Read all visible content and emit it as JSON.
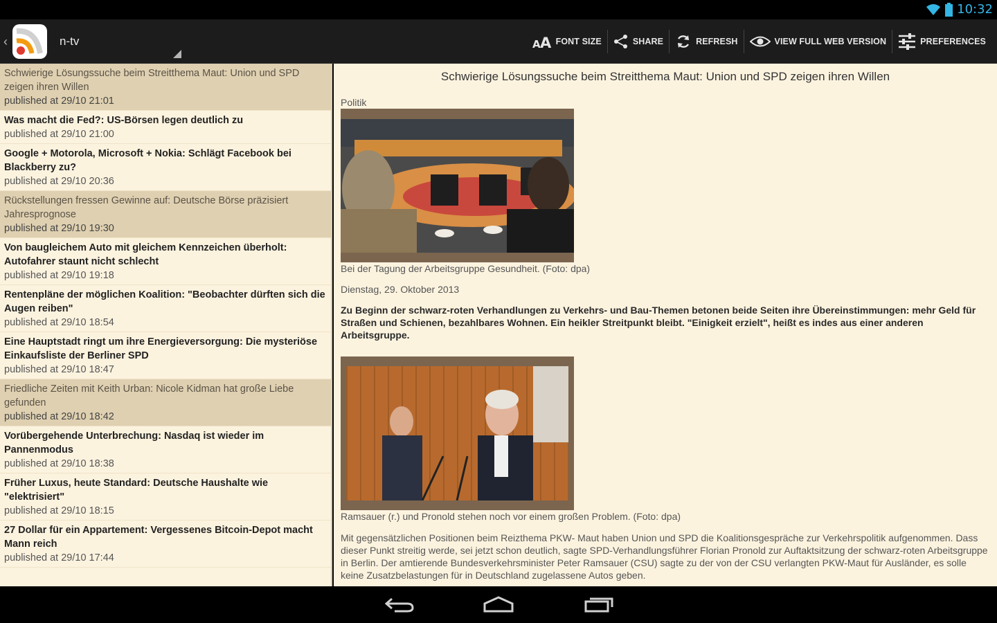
{
  "status": {
    "time": "10:32",
    "accent": "#33b5e5"
  },
  "appbar": {
    "title": "n-tv",
    "actions": [
      {
        "label": "FONT SIZE",
        "icon": "font-size-icon"
      },
      {
        "label": "SHARE",
        "icon": "share-icon"
      },
      {
        "label": "REFRESH",
        "icon": "refresh-icon"
      },
      {
        "label": "VIEW FULL WEB VERSION",
        "icon": "eye-icon"
      },
      {
        "label": "PREFERENCES",
        "icon": "sliders-icon"
      }
    ]
  },
  "list": {
    "items": [
      {
        "title": "Schwierige Lösungssuche beim Streitthema Maut: Union und SPD zeigen ihren Willen",
        "date": "published at 29/10 21:01",
        "read": true
      },
      {
        "title": "Was macht die Fed?: US-Börsen legen deutlich zu",
        "date": "published at 29/10 21:00",
        "read": false
      },
      {
        "title": "Google + Motorola, Microsoft + Nokia: Schlägt Facebook bei Blackberry zu?",
        "date": "published at 29/10 20:36",
        "read": false
      },
      {
        "title": "Rückstellungen fressen Gewinne auf: Deutsche Börse präzisiert Jahresprognose",
        "date": "published at 29/10 19:30",
        "read": true
      },
      {
        "title": "Von baugleichem Auto mit gleichem Kennzeichen überholt: Autofahrer staunt nicht schlecht",
        "date": "published at 29/10 19:18",
        "read": false
      },
      {
        "title": "Rentenpläne der möglichen Koalition: \"Beobachter dürften sich die Augen reiben\"",
        "date": "published at 29/10 18:54",
        "read": false
      },
      {
        "title": "Eine Hauptstadt ringt um ihre Energieversorgung: Die mysteriöse Einkaufsliste der Berliner SPD",
        "date": "published at 29/10 18:47",
        "read": false
      },
      {
        "title": "Friedliche Zeiten mit Keith Urban: Nicole Kidman hat große Liebe gefunden",
        "date": "published at 29/10 18:42",
        "read": true
      },
      {
        "title": "Vorübergehende Unterbrechung: Nasdaq ist wieder im Pannenmodus",
        "date": "published at 29/10 18:38",
        "read": false
      },
      {
        "title": "Früher Luxus, heute Standard: Deutsche Haushalte wie \"elektrisiert\"",
        "date": "published at 29/10 18:15",
        "read": false
      },
      {
        "title": "27 Dollar für ein Appartement: Vergessenes Bitcoin-Depot macht Mann reich",
        "date": "published at 29/10 17:44",
        "read": false
      }
    ]
  },
  "article": {
    "title": "Schwierige Lösungssuche beim Streitthema Maut: Union und SPD zeigen ihren Willen",
    "category": "Politik",
    "caption1": "Bei der Tagung der Arbeitsgruppe Gesundheit. (Foto: dpa)",
    "date": "Dienstag, 29. Oktober 2013",
    "lead": "Zu Beginn der schwarz-roten Verhandlungen zu Verkehrs- und Bau-Themen betonen beide Seiten ihre Übereinstimmungen: mehr Geld für Straßen und Schienen, bezahlbares Wohnen. Ein heikler Streitpunkt bleibt. \"Einigkeit erzielt\", heißt es indes aus einer anderen Arbeitsgruppe.",
    "caption2": "Ramsauer (r.) und Pronold stehen noch vor einem großen Problem. (Foto: dpa)",
    "body": "Mit gegensätzlichen Positionen beim Reizthema PKW- Maut haben Union und SPD die Koalitionsgespräche zur Verkehrspolitik aufgenommen. Dass dieser Punkt streitig werde, sei jetzt schon deutlich, sagte SPD-Verhandlungsführer Florian Pronold zur Auftaktsitzung der schwarz-roten Arbeitsgruppe in Berlin. Der amtierende Bundesverkehrsminister Peter Ramsauer (CSU) sagte zu der von der CSU verlangten PKW-Maut für Ausländer, es solle keine Zusatzbelastungen für in Deutschland zugelassene Autos geben."
  },
  "nav": {
    "back": "back-icon",
    "home": "home-icon",
    "recents": "recents-icon"
  }
}
